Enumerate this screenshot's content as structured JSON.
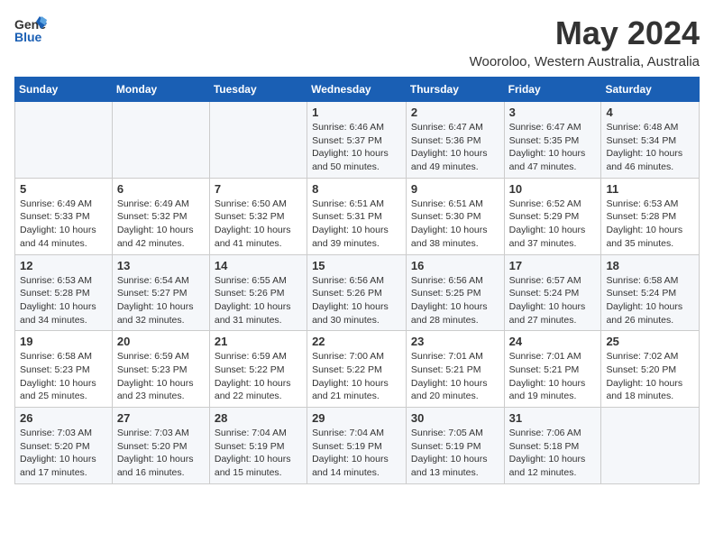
{
  "header": {
    "logo_general": "General",
    "logo_blue": "Blue",
    "month_title": "May 2024",
    "location": "Wooroloo, Western Australia, Australia"
  },
  "weekdays": [
    "Sunday",
    "Monday",
    "Tuesday",
    "Wednesday",
    "Thursday",
    "Friday",
    "Saturday"
  ],
  "weeks": [
    [
      {
        "day": "",
        "detail": ""
      },
      {
        "day": "",
        "detail": ""
      },
      {
        "day": "",
        "detail": ""
      },
      {
        "day": "1",
        "detail": "Sunrise: 6:46 AM\nSunset: 5:37 PM\nDaylight: 10 hours\nand 50 minutes."
      },
      {
        "day": "2",
        "detail": "Sunrise: 6:47 AM\nSunset: 5:36 PM\nDaylight: 10 hours\nand 49 minutes."
      },
      {
        "day": "3",
        "detail": "Sunrise: 6:47 AM\nSunset: 5:35 PM\nDaylight: 10 hours\nand 47 minutes."
      },
      {
        "day": "4",
        "detail": "Sunrise: 6:48 AM\nSunset: 5:34 PM\nDaylight: 10 hours\nand 46 minutes."
      }
    ],
    [
      {
        "day": "5",
        "detail": "Sunrise: 6:49 AM\nSunset: 5:33 PM\nDaylight: 10 hours\nand 44 minutes."
      },
      {
        "day": "6",
        "detail": "Sunrise: 6:49 AM\nSunset: 5:32 PM\nDaylight: 10 hours\nand 42 minutes."
      },
      {
        "day": "7",
        "detail": "Sunrise: 6:50 AM\nSunset: 5:32 PM\nDaylight: 10 hours\nand 41 minutes."
      },
      {
        "day": "8",
        "detail": "Sunrise: 6:51 AM\nSunset: 5:31 PM\nDaylight: 10 hours\nand 39 minutes."
      },
      {
        "day": "9",
        "detail": "Sunrise: 6:51 AM\nSunset: 5:30 PM\nDaylight: 10 hours\nand 38 minutes."
      },
      {
        "day": "10",
        "detail": "Sunrise: 6:52 AM\nSunset: 5:29 PM\nDaylight: 10 hours\nand 37 minutes."
      },
      {
        "day": "11",
        "detail": "Sunrise: 6:53 AM\nSunset: 5:28 PM\nDaylight: 10 hours\nand 35 minutes."
      }
    ],
    [
      {
        "day": "12",
        "detail": "Sunrise: 6:53 AM\nSunset: 5:28 PM\nDaylight: 10 hours\nand 34 minutes."
      },
      {
        "day": "13",
        "detail": "Sunrise: 6:54 AM\nSunset: 5:27 PM\nDaylight: 10 hours\nand 32 minutes."
      },
      {
        "day": "14",
        "detail": "Sunrise: 6:55 AM\nSunset: 5:26 PM\nDaylight: 10 hours\nand 31 minutes."
      },
      {
        "day": "15",
        "detail": "Sunrise: 6:56 AM\nSunset: 5:26 PM\nDaylight: 10 hours\nand 30 minutes."
      },
      {
        "day": "16",
        "detail": "Sunrise: 6:56 AM\nSunset: 5:25 PM\nDaylight: 10 hours\nand 28 minutes."
      },
      {
        "day": "17",
        "detail": "Sunrise: 6:57 AM\nSunset: 5:24 PM\nDaylight: 10 hours\nand 27 minutes."
      },
      {
        "day": "18",
        "detail": "Sunrise: 6:58 AM\nSunset: 5:24 PM\nDaylight: 10 hours\nand 26 minutes."
      }
    ],
    [
      {
        "day": "19",
        "detail": "Sunrise: 6:58 AM\nSunset: 5:23 PM\nDaylight: 10 hours\nand 25 minutes."
      },
      {
        "day": "20",
        "detail": "Sunrise: 6:59 AM\nSunset: 5:23 PM\nDaylight: 10 hours\nand 23 minutes."
      },
      {
        "day": "21",
        "detail": "Sunrise: 6:59 AM\nSunset: 5:22 PM\nDaylight: 10 hours\nand 22 minutes."
      },
      {
        "day": "22",
        "detail": "Sunrise: 7:00 AM\nSunset: 5:22 PM\nDaylight: 10 hours\nand 21 minutes."
      },
      {
        "day": "23",
        "detail": "Sunrise: 7:01 AM\nSunset: 5:21 PM\nDaylight: 10 hours\nand 20 minutes."
      },
      {
        "day": "24",
        "detail": "Sunrise: 7:01 AM\nSunset: 5:21 PM\nDaylight: 10 hours\nand 19 minutes."
      },
      {
        "day": "25",
        "detail": "Sunrise: 7:02 AM\nSunset: 5:20 PM\nDaylight: 10 hours\nand 18 minutes."
      }
    ],
    [
      {
        "day": "26",
        "detail": "Sunrise: 7:03 AM\nSunset: 5:20 PM\nDaylight: 10 hours\nand 17 minutes."
      },
      {
        "day": "27",
        "detail": "Sunrise: 7:03 AM\nSunset: 5:20 PM\nDaylight: 10 hours\nand 16 minutes."
      },
      {
        "day": "28",
        "detail": "Sunrise: 7:04 AM\nSunset: 5:19 PM\nDaylight: 10 hours\nand 15 minutes."
      },
      {
        "day": "29",
        "detail": "Sunrise: 7:04 AM\nSunset: 5:19 PM\nDaylight: 10 hours\nand 14 minutes."
      },
      {
        "day": "30",
        "detail": "Sunrise: 7:05 AM\nSunset: 5:19 PM\nDaylight: 10 hours\nand 13 minutes."
      },
      {
        "day": "31",
        "detail": "Sunrise: 7:06 AM\nSunset: 5:18 PM\nDaylight: 10 hours\nand 12 minutes."
      },
      {
        "day": "",
        "detail": ""
      }
    ]
  ]
}
